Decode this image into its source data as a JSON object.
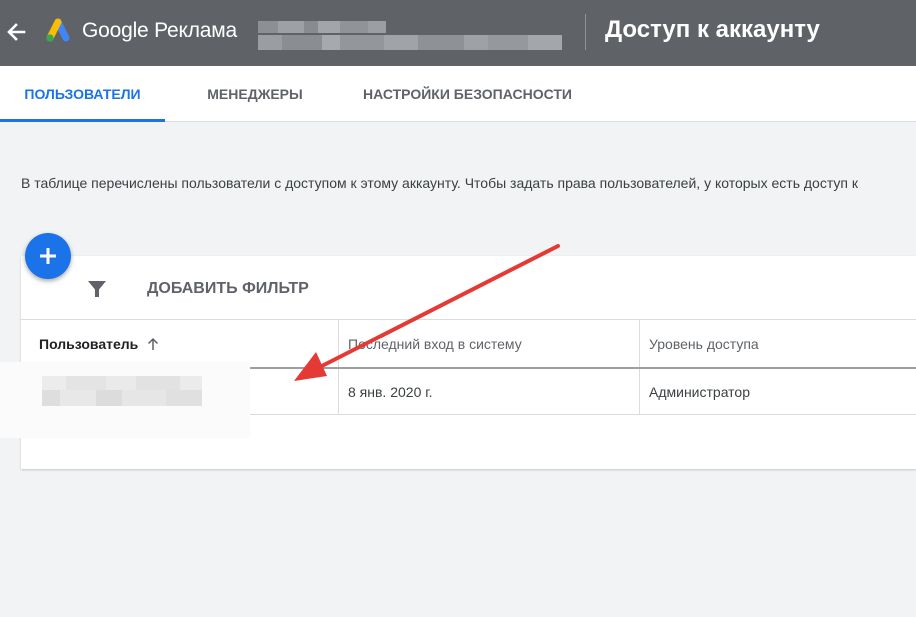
{
  "header": {
    "back_icon": "arrow-back-icon",
    "logo_icon": "google-ads-logo-icon",
    "product_name": "Google Реклама",
    "page_title": "Доступ к аккаунту"
  },
  "tabs": [
    {
      "label": "ПОЛЬЗОВАТЕЛИ",
      "active": true
    },
    {
      "label": "МЕНЕДЖЕРЫ",
      "active": false
    },
    {
      "label": "НАСТРОЙКИ БЕЗОПАСНОСТИ",
      "active": false
    }
  ],
  "description": "В таблице перечислены пользователи с доступом к этому аккаунту. Чтобы задать права пользователей, у которых есть доступ к",
  "filter": {
    "icon": "filter-icon",
    "add_label": "ДОБАВИТЬ ФИЛЬТР"
  },
  "table": {
    "columns": [
      "Пользователь",
      "Последний вход в систему",
      "Уровень доступа"
    ],
    "sort_icon": "arrow-upward-icon",
    "rows": [
      {
        "user": "",
        "last_login": "8 янв. 2020 г.",
        "access_level": "Администратор"
      }
    ]
  },
  "fab": {
    "icon": "add-icon"
  },
  "colors": {
    "header_bg": "#5f6368",
    "accent": "#1a73e8",
    "page_bg": "#f1f3f4",
    "annotation": "#e53935"
  }
}
